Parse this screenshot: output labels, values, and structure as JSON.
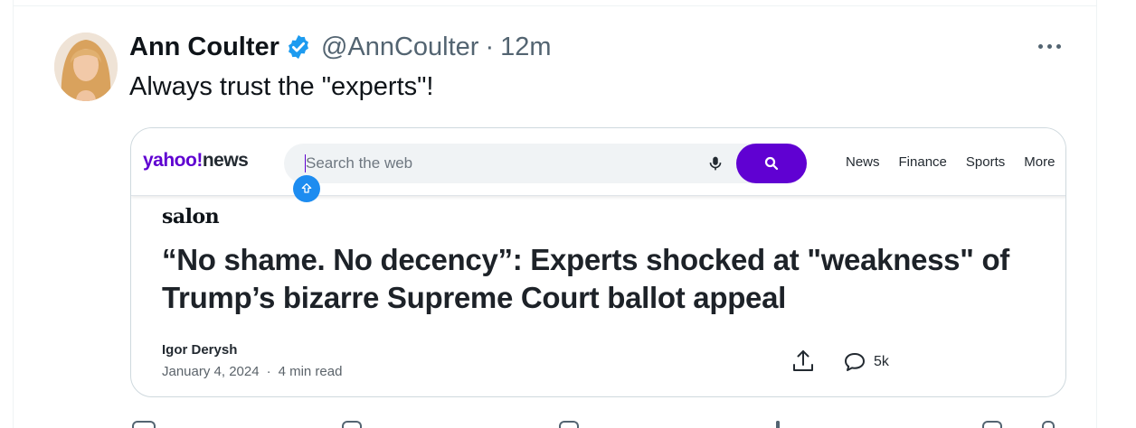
{
  "tweet": {
    "author_name": "Ann Coulter",
    "handle": "@AnnCoulter",
    "separator": "·",
    "time": "12m",
    "text": "Always trust the \"experts\"!",
    "avatar_icon": "avatar-photo",
    "verified_icon": "verified-badge-icon",
    "more_icon": "more-options-icon",
    "verified_color": "#1d9bf0"
  },
  "card": {
    "nav": {
      "logo_main": "yahoo!",
      "logo_news": "news",
      "search_placeholder": "Search the web",
      "links": [
        "News",
        "Finance",
        "Sports",
        "More"
      ],
      "brand_color": "#6001d2"
    },
    "source": "salon",
    "headline": "“No shame. No decency”: Experts shocked at \"weakness\" of Trump’s bizarre Supreme Court ballot appeal",
    "author": "Igor Derysh",
    "date": "January 4, 2024",
    "dot": "·",
    "read_time": "4 min read",
    "comment_count": "5k"
  }
}
